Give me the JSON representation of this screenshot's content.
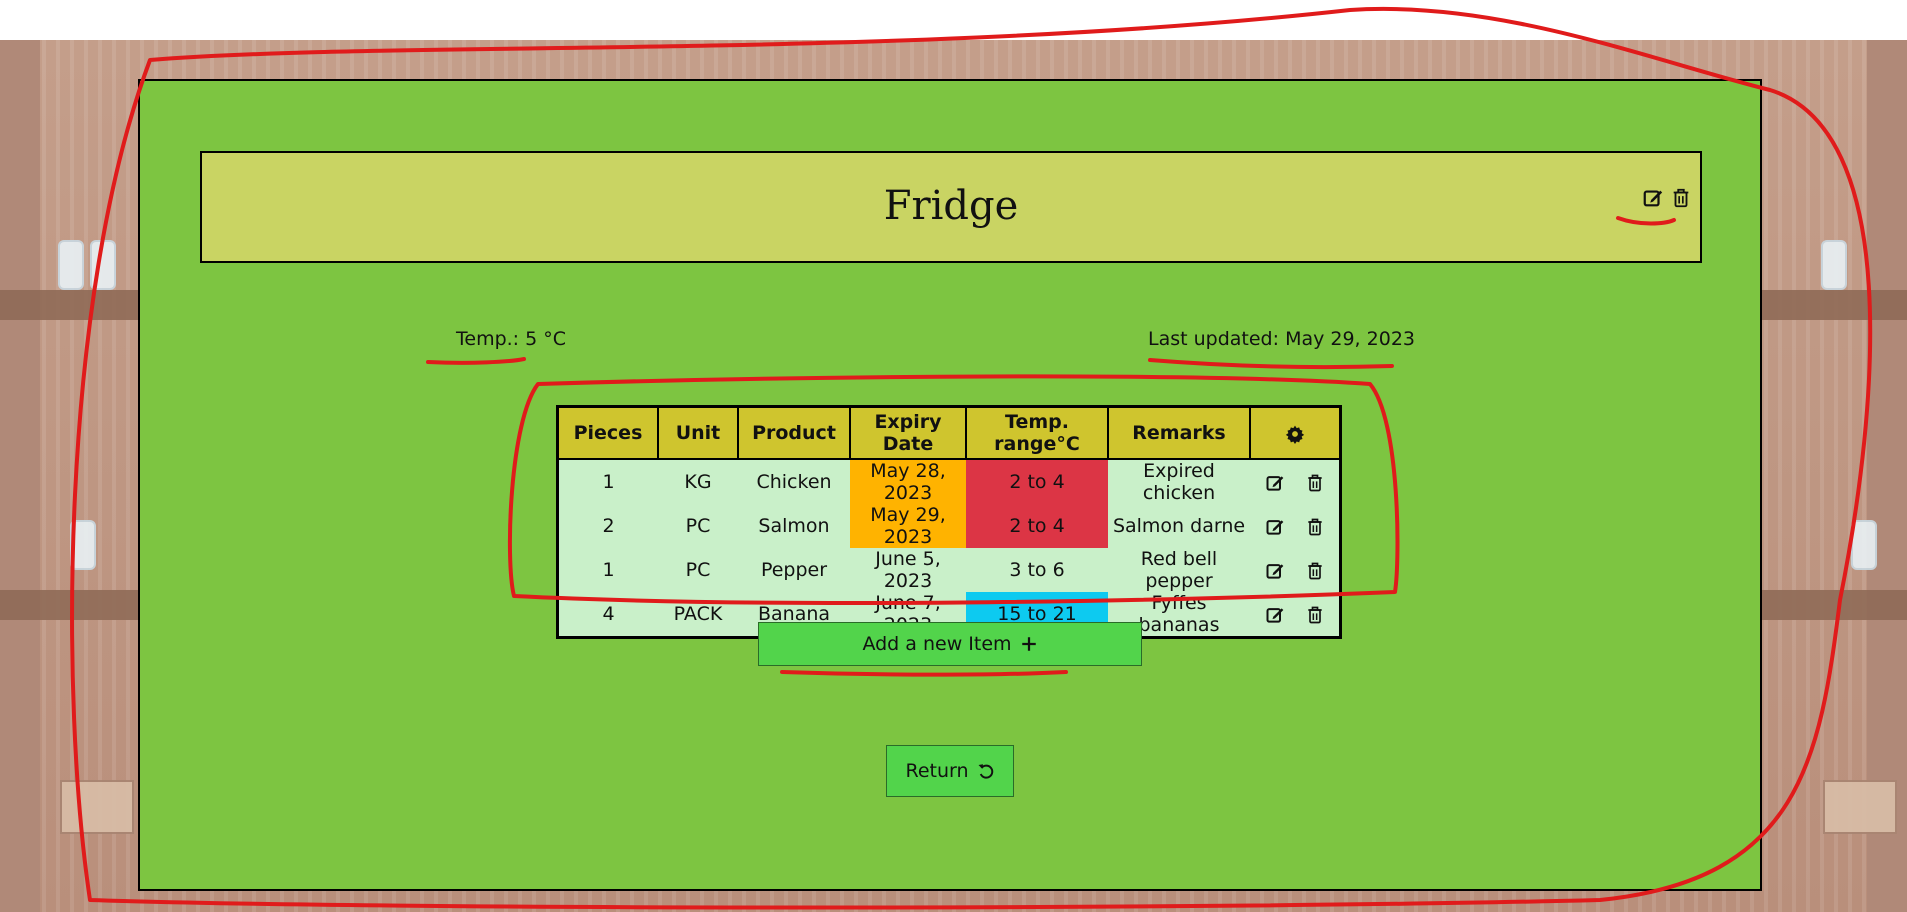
{
  "fridge": {
    "title": "Fridge",
    "temperature_text": "Temp.: 5 °C",
    "last_updated_text": "Last updated: May 29, 2023"
  },
  "table": {
    "headers": [
      "Pieces",
      "Unit",
      "Product",
      "Expiry Date",
      "Temp. range°C",
      "Remarks"
    ],
    "settings_icon": "gear-icon",
    "rows": [
      {
        "pieces": "1",
        "unit": "KG",
        "product": "Chicken",
        "expiry": "May 28, 2023",
        "temp_range": "2 to 4",
        "remarks": "Expired chicken",
        "expiry_status": "warn",
        "temp_status": "hot"
      },
      {
        "pieces": "2",
        "unit": "PC",
        "product": "Salmon",
        "expiry": "May 29, 2023",
        "temp_range": "2 to 4",
        "remarks": "Salmon darne",
        "expiry_status": "warn",
        "temp_status": "hot"
      },
      {
        "pieces": "1",
        "unit": "PC",
        "product": "Pepper",
        "expiry": "June 5, 2023",
        "temp_range": "3 to 6",
        "remarks": "Red bell pepper",
        "expiry_status": "ok",
        "temp_status": "ok"
      },
      {
        "pieces": "4",
        "unit": "PACK",
        "product": "Banana",
        "expiry": "June 7, 2023",
        "temp_range": "15 to 21",
        "remarks": "Fyffes bananas",
        "expiry_status": "ok",
        "temp_status": "cold"
      }
    ]
  },
  "buttons": {
    "add_label": "Add a new Item",
    "add_icon": "plus-icon",
    "return_label": "Return",
    "return_icon": "undo-icon"
  },
  "colors": {
    "panel": "#7dc541",
    "title_bar": "#c9d463",
    "header": "#cfc52e",
    "row": "#c9f0c9",
    "warn": "#ffb300",
    "hot": "#dc3545",
    "cold": "#0dcaf0",
    "button": "#52d44b",
    "annotation": "#e01b1b"
  }
}
